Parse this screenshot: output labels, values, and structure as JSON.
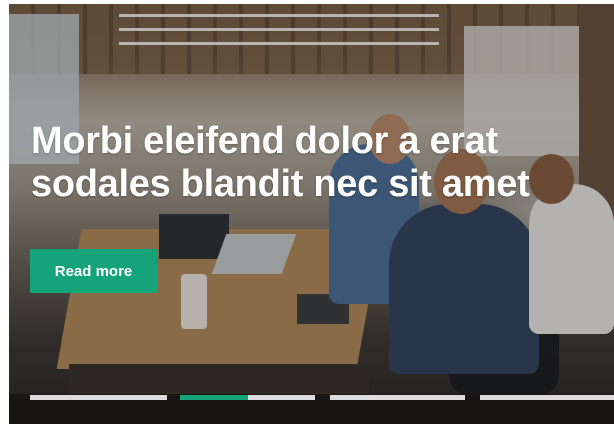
{
  "hero": {
    "headline": "Morbi eleifend dolor a erat sodales blandit nec sit amet",
    "cta_label": "Read more",
    "accent_color": "#15a47a",
    "background_image": "office-team-working-photo"
  },
  "carousel": {
    "slide_count": 4,
    "active_index": 1,
    "active_progress": 0.5
  }
}
